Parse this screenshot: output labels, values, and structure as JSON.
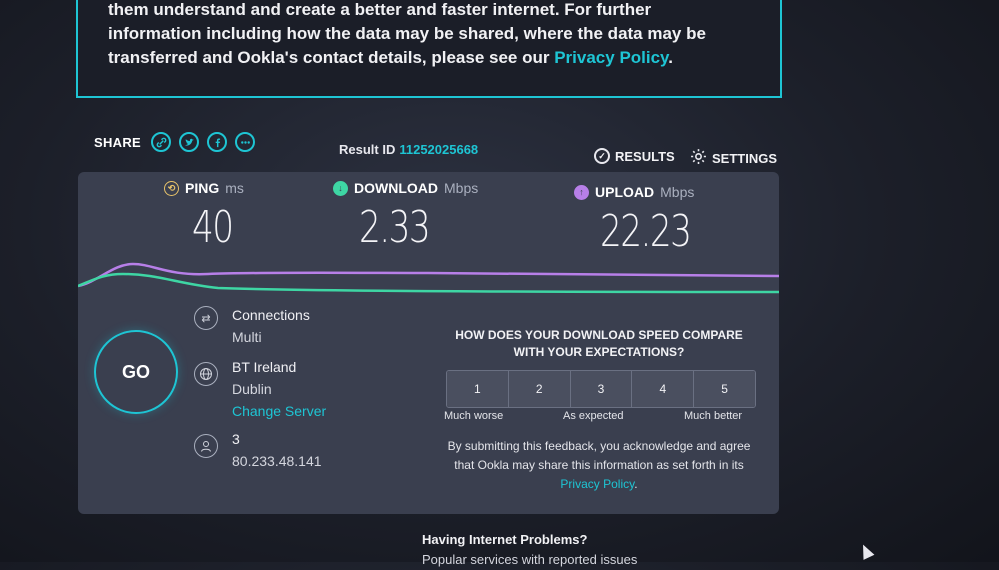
{
  "notice": {
    "line1": "them understand and create a better and faster internet. For further",
    "line2": "information including how the data may be shared, where the data may be",
    "line3_prefix": "transferred and Ookla's contact details, please see our ",
    "privacy_link": "Privacy Policy",
    "line3_suffix": "."
  },
  "share": {
    "label": "SHARE",
    "icons": [
      "link-icon",
      "twitter-icon",
      "facebook-icon",
      "more-icon"
    ]
  },
  "result": {
    "label": "Result ID",
    "id": "11252025668"
  },
  "top_actions": {
    "results": "RESULTS",
    "settings": "SETTINGS"
  },
  "metrics": {
    "ping": {
      "label": "PING",
      "unit": "ms",
      "value": "40"
    },
    "download": {
      "label": "DOWNLOAD",
      "unit": "Mbps",
      "value": "2.33"
    },
    "upload": {
      "label": "UPLOAD",
      "unit": "Mbps",
      "value": "22.23"
    }
  },
  "go_label": "GO",
  "connection": {
    "connections_label": "Connections",
    "connections_value": "Multi",
    "isp": "BT Ireland",
    "location": "Dublin",
    "change_server": "Change Server",
    "host_label": "3",
    "ip": "80.233.48.141"
  },
  "survey": {
    "question": "HOW DOES YOUR DOWNLOAD SPEED COMPARE WITH YOUR EXPECTATIONS?",
    "options": [
      "1",
      "2",
      "3",
      "4",
      "5"
    ],
    "low_label": "Much worse",
    "mid_label": "As expected",
    "high_label": "Much better",
    "feedback_text": "By submitting this feedback, you acknowledge and agree that Ookla may share this information as set forth in its ",
    "feedback_link": "Privacy Policy",
    "feedback_end": "."
  },
  "help": {
    "heading": "Having Internet Problems?",
    "sub": "Popular services with reported issues"
  },
  "colors": {
    "accent": "#1ec5d4",
    "upload": "#b77fe8",
    "download": "#3ed6a4",
    "panel": "#3a3f4f"
  }
}
